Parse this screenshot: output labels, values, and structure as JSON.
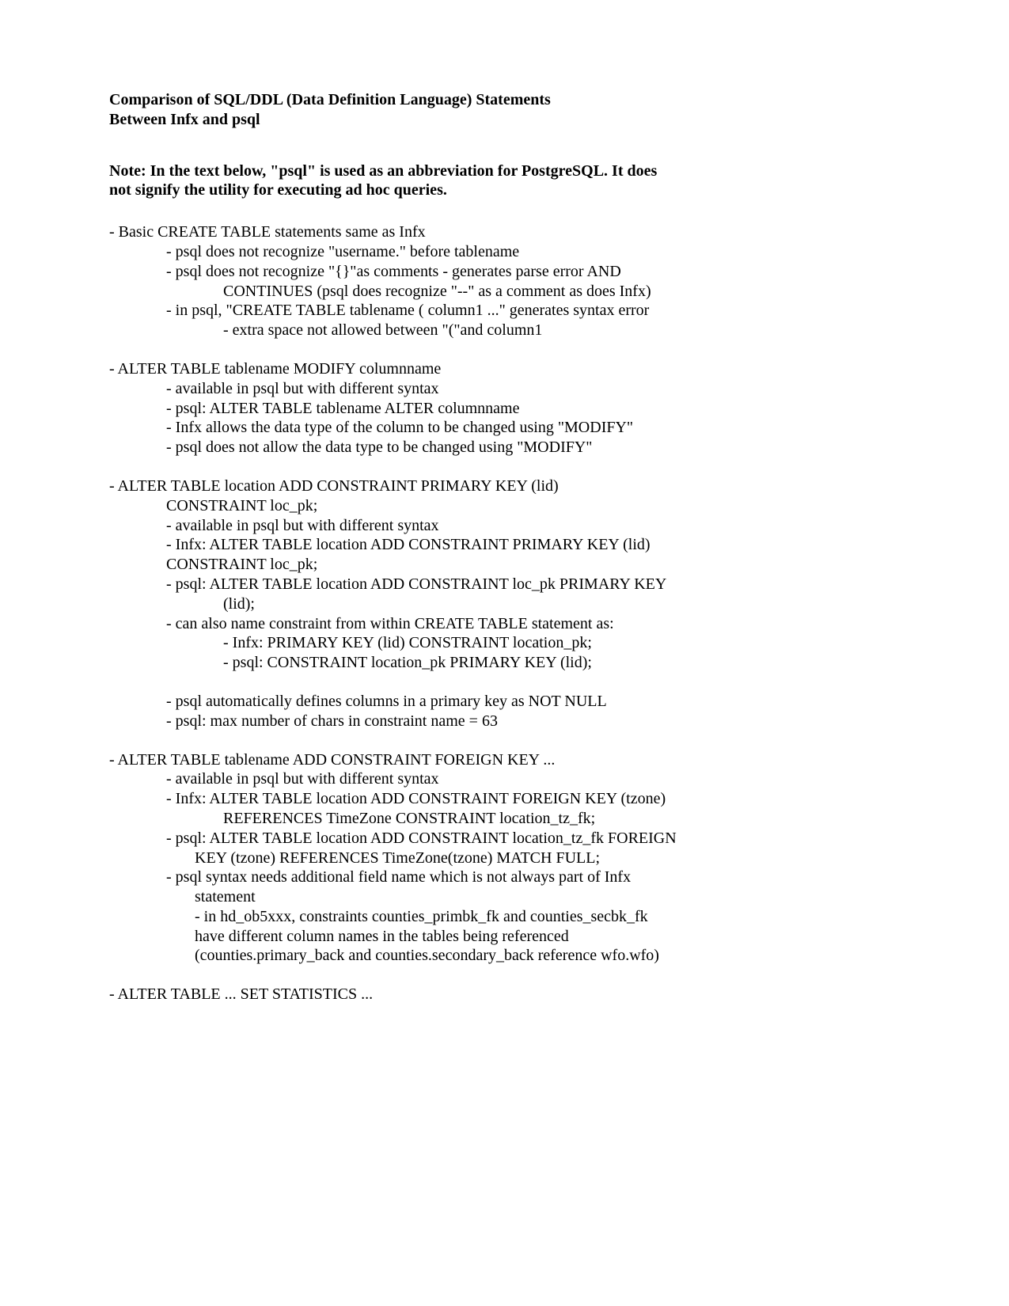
{
  "title_line1": "Comparison of SQL/DDL (Data Definition Language) Statements",
  "title_line2": "Between Infx and psql",
  "note_line1": "Note:  In the text below, \"psql\" is used as an abbreviation for PostgreSQL.  It does",
  "note_line2": "not signify the utility for executing ad hoc queries.",
  "sections": [
    {
      "head": "- Basic CREATE TABLE statements same as Infx",
      "lines": [
        {
          "cls": "l1",
          "t": "- psql does not recognize \"username.\" before tablename"
        },
        {
          "cls": "l1",
          "t": "- psql does not recognize \"{}\"as comments - generates parse error AND"
        },
        {
          "cls": "l2",
          "t": "CONTINUES (psql does recognize \"--\" as a comment as does Infx)"
        },
        {
          "cls": "l1",
          "t": "- in psql, \"CREATE TABLE tablename ( column1 ...\"  generates syntax error"
        },
        {
          "cls": "l2",
          "t": "- extra space not allowed between \"(\"and column1"
        }
      ]
    },
    {
      "head": "- ALTER TABLE tablename MODIFY columnname",
      "lines": [
        {
          "cls": "l1",
          "t": "- available in psql but with different syntax"
        },
        {
          "cls": "l1",
          "t": "- psql: ALTER TABLE tablename ALTER columnname"
        },
        {
          "cls": "l1",
          "t": "- Infx allows the data type of the column to be changed using \"MODIFY\""
        },
        {
          "cls": "l1",
          "t": "- psql does not allow the data type to be changed using \"MODIFY\""
        }
      ]
    },
    {
      "head": "- ALTER TABLE  location  ADD  CONSTRAINT  PRIMARY  KEY  (lid)",
      "head2": "CONSTRAINT  loc_pk;",
      "lines": [
        {
          "cls": "l1",
          "t": "- available in psql but with different syntax"
        },
        {
          "cls": "l1",
          "t": "- Infx: ALTER TABLE location ADD CONSTRAINT PRIMARY KEY (lid)"
        },
        {
          "cls": "l1",
          "t": "CONSTRAINT loc_pk;"
        },
        {
          "cls": "l1",
          "t": "- psql: ALTER TABLE location ADD CONSTRAINT loc_pk PRIMARY KEY"
        },
        {
          "cls": "l2",
          "t": "(lid);"
        },
        {
          "cls": "l1",
          "t": "- can also name constraint from within CREATE TABLE statement as:"
        },
        {
          "cls": "l2",
          "t": "- Infx: PRIMARY KEY (lid) CONSTRAINT location_pk;"
        },
        {
          "cls": "l2",
          "t": "- psql: CONSTRAINT location_pk PRIMARY KEY (lid);"
        },
        {
          "cls": "spacer",
          "t": ""
        },
        {
          "cls": "l1",
          "t": "- psql automatically defines columns in a primary key as NOT NULL"
        },
        {
          "cls": "l1",
          "t": "- psql: max number of chars in constraint name = 63"
        }
      ]
    },
    {
      "head": "- ALTER TABLE  tablename  ADD  CONSTRAINT  FOREIGN  KEY ...",
      "lines": [
        {
          "cls": "l1",
          "t": "- available in psql but with different syntax"
        },
        {
          "cls": "l1",
          "t": "- Infx: ALTER TABLE location ADD CONSTRAINT FOREIGN KEY (tzone)"
        },
        {
          "cls": "l2",
          "t": "REFERENCES TimeZone CONSTRAINT location_tz_fk;"
        },
        {
          "cls": "l1",
          "t": "- psql: ALTER TABLE location ADD CONSTRAINT location_tz_fk FOREIGN"
        },
        {
          "cls": "l3",
          "t": " KEY (tzone) REFERENCES TimeZone(tzone) MATCH FULL;"
        },
        {
          "cls": "l1",
          "t": "- psql syntax needs additional field name which is not always part of Infx"
        },
        {
          "cls": "l3",
          "t": "statement"
        },
        {
          "cls": "l3",
          "t": "- in hd_ob5xxx, constraints counties_primbk_fk and counties_secbk_fk"
        },
        {
          "cls": "l3",
          "t": "have different column names in the tables being referenced"
        },
        {
          "cls": "l3",
          "t": "(counties.primary_back  and counties.secondary_back reference wfo.wfo)"
        }
      ]
    },
    {
      "head": "- ALTER TABLE ... SET STATISTICS ...",
      "lines": []
    }
  ]
}
